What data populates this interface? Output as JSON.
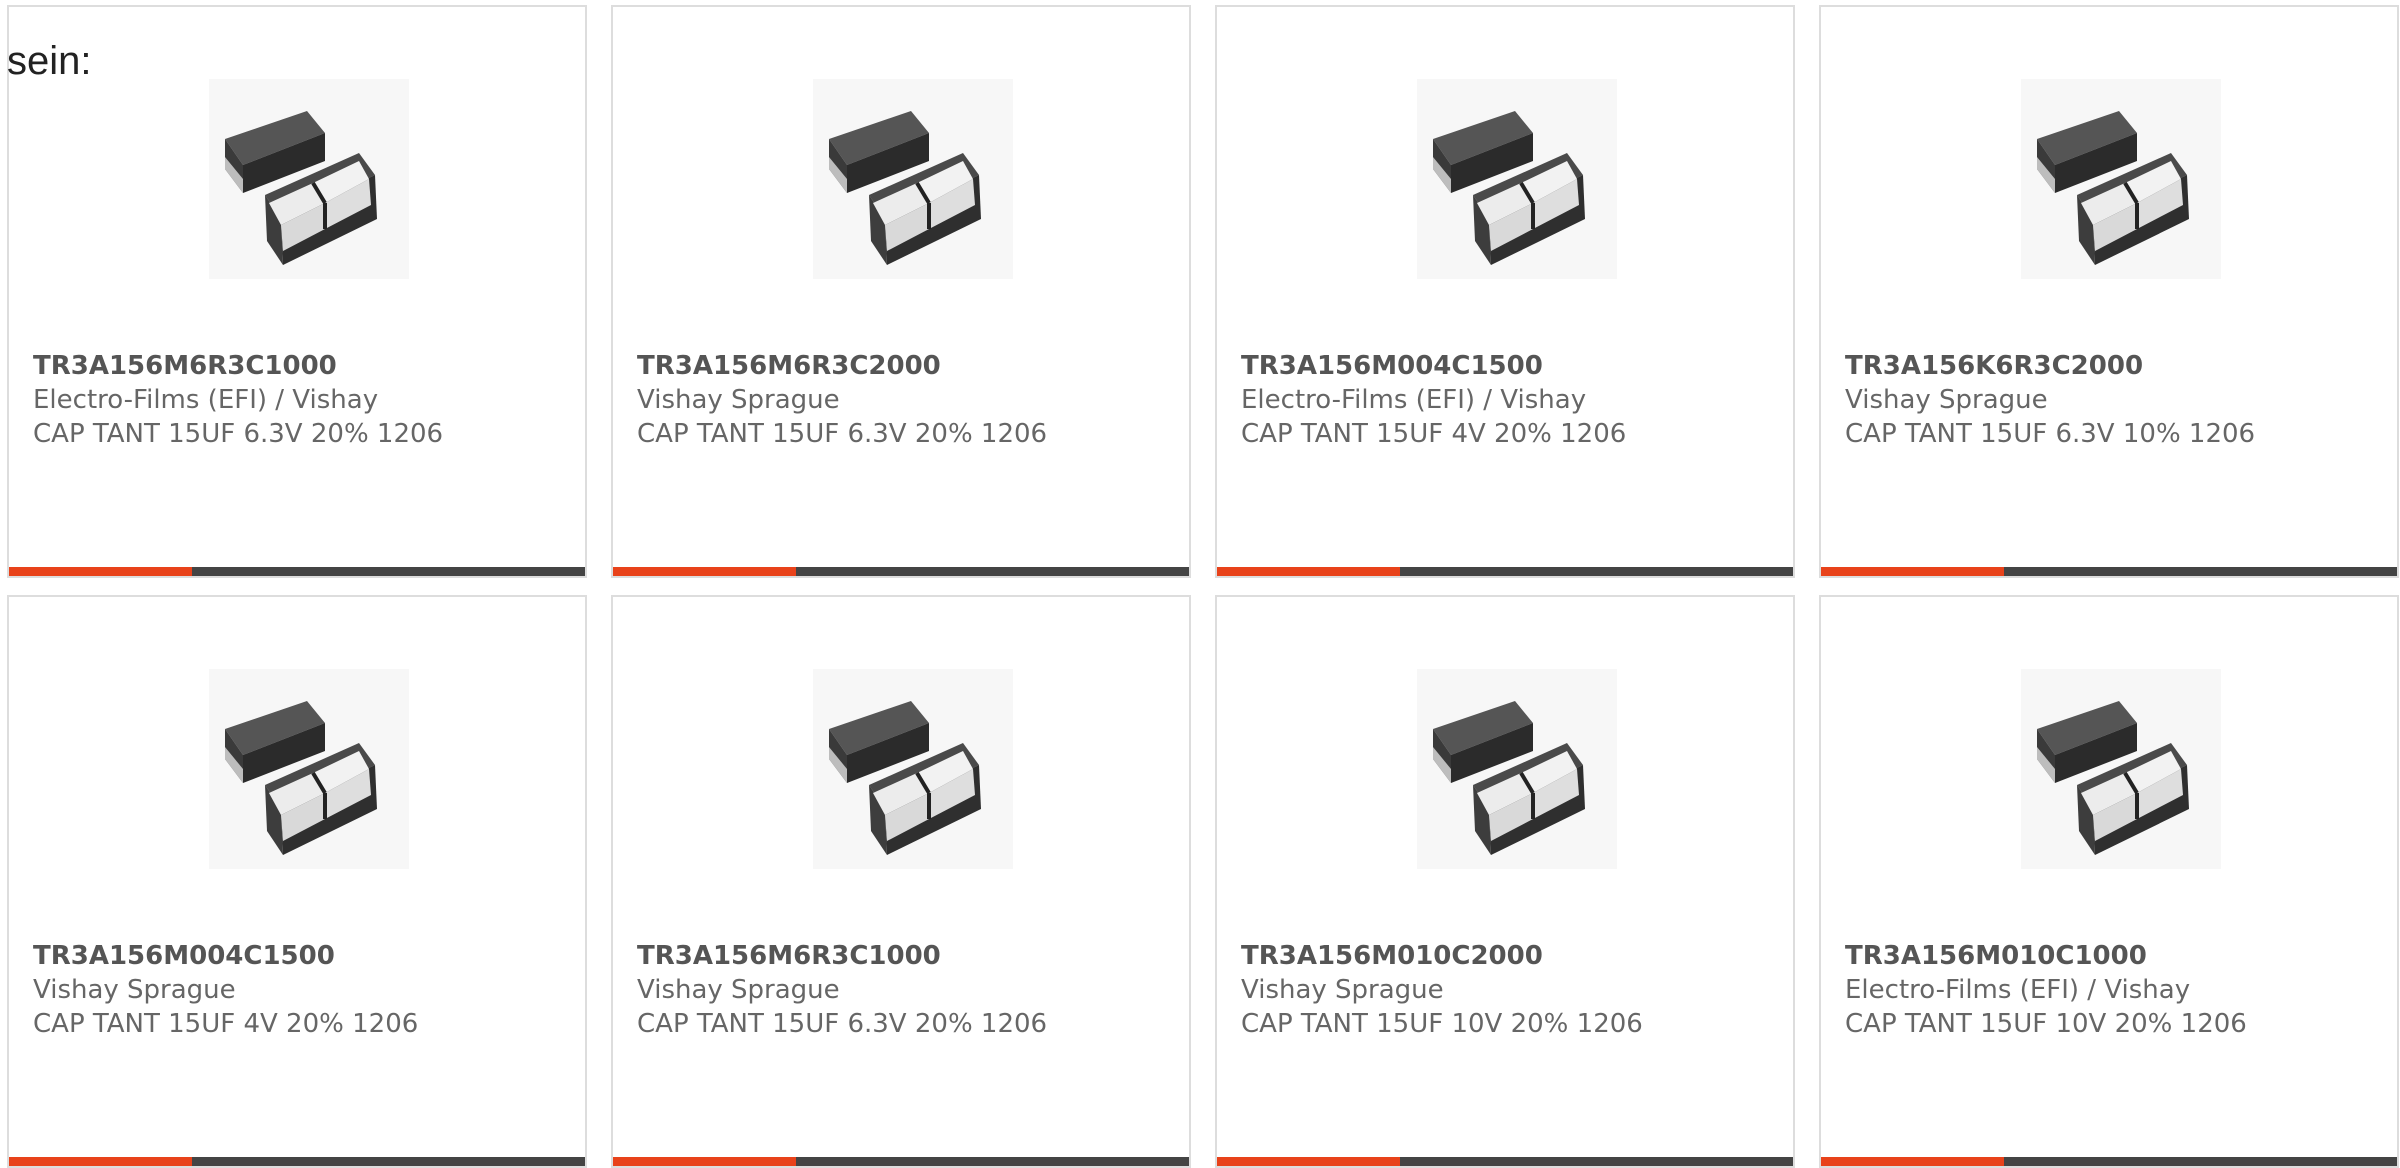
{
  "intro": {
    "text": "sein:"
  },
  "image_icon": "capacitor-chip-image",
  "colors": {
    "accent": "#e8421a",
    "bar": "#444444",
    "border": "#dddddd"
  },
  "products": [
    {
      "part": "TR3A156M6R3C1000",
      "manufacturer": "Electro-Films (EFI) / Vishay",
      "description": "CAP TANT 15UF 6.3V 20% 1206"
    },
    {
      "part": "TR3A156M6R3C2000",
      "manufacturer": "Vishay Sprague",
      "description": "CAP TANT 15UF 6.3V 20% 1206"
    },
    {
      "part": "TR3A156M004C1500",
      "manufacturer": "Electro-Films (EFI) / Vishay",
      "description": "CAP TANT 15UF 4V 20% 1206"
    },
    {
      "part": "TR3A156K6R3C2000",
      "manufacturer": "Vishay Sprague",
      "description": "CAP TANT 15UF 6.3V 10% 1206"
    },
    {
      "part": "TR3A156M004C1500",
      "manufacturer": "Vishay Sprague",
      "description": "CAP TANT 15UF 4V 20% 1206"
    },
    {
      "part": "TR3A156M6R3C1000",
      "manufacturer": "Vishay Sprague",
      "description": "CAP TANT 15UF 6.3V 20% 1206"
    },
    {
      "part": "TR3A156M010C2000",
      "manufacturer": "Vishay Sprague",
      "description": "CAP TANT 15UF 10V 20% 1206"
    },
    {
      "part": "TR3A156M010C1000",
      "manufacturer": "Electro-Films (EFI) / Vishay",
      "description": "CAP TANT 15UF 10V 20% 1206"
    }
  ]
}
